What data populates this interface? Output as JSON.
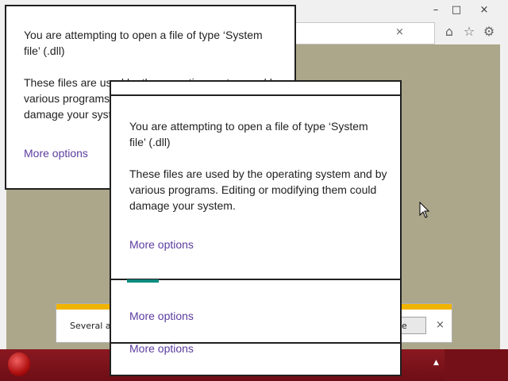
{
  "browser": {
    "window_controls": {
      "minimize": "–",
      "maximize": "□",
      "close": "×"
    },
    "address_bar": {
      "clear": "×"
    },
    "tools": {
      "home": "⌂",
      "favorites": "☆",
      "settings": "⚙"
    }
  },
  "notification_bar": {
    "text": "Several ad",
    "button_label": "ble",
    "close": "×"
  },
  "dialog_back": {
    "heading": "You are attempting to open a file of type ‘System file’ (.dll)",
    "body": "These files are used by the operating system and by various programs. Editing or modifying them could damage your system.",
    "link": "More options"
  },
  "dialog_front": {
    "heading": "You are attempting to open a file of type ‘System file’ (.dll)",
    "body": "These files are used by the operating system and by various programs. Editing or modifying them could damage your system.",
    "link": "More options",
    "link2": "More options",
    "link3": "More options"
  },
  "taskbar": {
    "tray_arrow": "▲"
  },
  "colors": {
    "page_bg": "#aca78a",
    "link": "#5b3c9f",
    "taskbar": "#7a1018",
    "notif_accent": "#f0b400",
    "teal_accent": "#0b8a80"
  }
}
